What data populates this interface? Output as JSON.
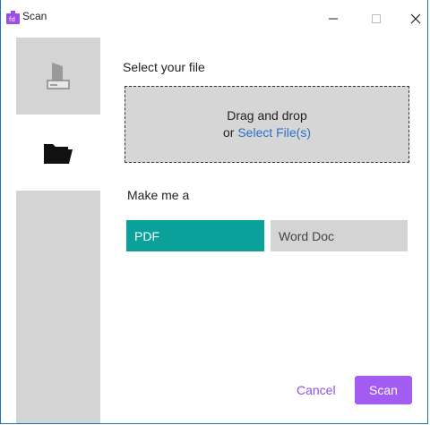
{
  "window": {
    "title": "Scan"
  },
  "sidebar": {
    "items": [
      {
        "name": "scanner",
        "icon": "scanner-icon"
      },
      {
        "name": "folder",
        "icon": "folder-open-icon"
      }
    ]
  },
  "main": {
    "select_label": "Select your file",
    "drop_text": "Drag and drop",
    "drop_or": "or",
    "drop_link": "Select File(s)",
    "make_label": "Make me a",
    "formats": [
      "PDF",
      "Word Doc"
    ],
    "selected_format": "PDF"
  },
  "footer": {
    "cancel_label": "Cancel",
    "scan_label": "Scan"
  },
  "colors": {
    "accent_teal": "#0aa19a",
    "accent_purple": "#a35cf2",
    "link_blue": "#2a6fc9"
  }
}
